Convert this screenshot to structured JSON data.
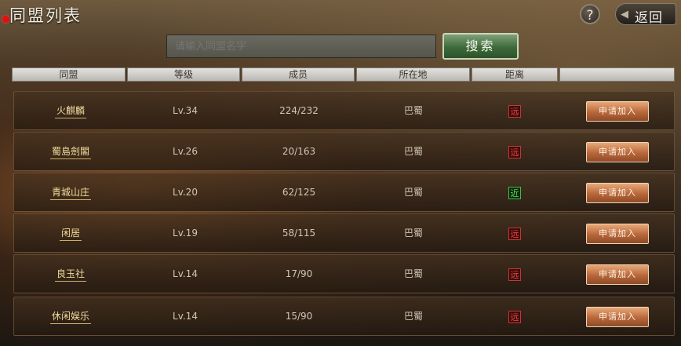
{
  "header": {
    "title": "同盟列表",
    "help_label": "?",
    "back_label": "返回"
  },
  "search": {
    "placeholder": "请输入同盟名字",
    "button_label": "搜索"
  },
  "table": {
    "columns": [
      "同盟",
      "等级",
      "成员",
      "所在地",
      "距离",
      ""
    ],
    "rows": [
      {
        "name": "火麒麟",
        "level": "Lv.34",
        "members": "224/232",
        "location": "巴蜀",
        "distance": "远",
        "distance_type": "far",
        "action": "申请加入"
      },
      {
        "name": "蜀島劍閣",
        "level": "Lv.26",
        "members": "20/163",
        "location": "巴蜀",
        "distance": "远",
        "distance_type": "far",
        "action": "申请加入"
      },
      {
        "name": "青城山庄",
        "level": "Lv.20",
        "members": "62/125",
        "location": "巴蜀",
        "distance": "近",
        "distance_type": "near",
        "action": "申请加入"
      },
      {
        "name": "闲居",
        "level": "Lv.19",
        "members": "58/115",
        "location": "巴蜀",
        "distance": "远",
        "distance_type": "far",
        "action": "申请加入"
      },
      {
        "name": "良玉社",
        "level": "Lv.14",
        "members": "17/90",
        "location": "巴蜀",
        "distance": "远",
        "distance_type": "far",
        "action": "申请加入"
      },
      {
        "name": "休闲娱乐",
        "level": "Lv.14",
        "members": "15/90",
        "location": "巴蜀",
        "distance": "远",
        "distance_type": "far",
        "action": "申请加入"
      }
    ]
  },
  "colors": {
    "far": "#e44444",
    "near": "#55dd55",
    "search_button": "#3e6a3b",
    "join_button": "#b8673a"
  }
}
